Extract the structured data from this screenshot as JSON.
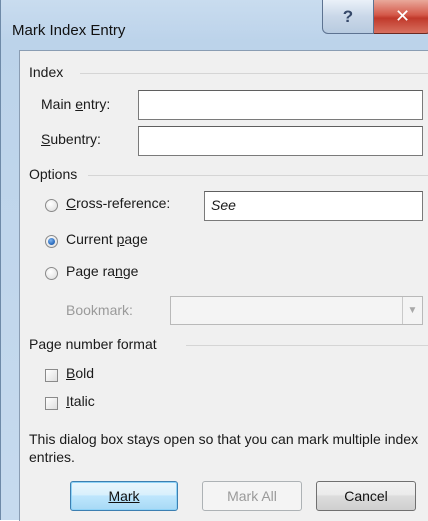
{
  "window": {
    "title": "Mark Index Entry",
    "help_glyph": "?",
    "close_glyph": "✕"
  },
  "index_group": {
    "label": "Index",
    "main_entry": {
      "pre": "Main ",
      "key": "e",
      "post": "ntry:",
      "value": ""
    },
    "subentry": {
      "pre": "",
      "key": "S",
      "post": "ubentry:",
      "value": ""
    }
  },
  "options_group": {
    "label": "Options",
    "cross_reference": {
      "pre": "",
      "key": "C",
      "post": "ross-reference:",
      "value": "See",
      "selected": false
    },
    "current_page": {
      "label": "Current page",
      "pre": "Current ",
      "key": "p",
      "post": "age",
      "selected": true
    },
    "page_range": {
      "pre": "Page ra",
      "key": "n",
      "post": "ge",
      "selected": false
    },
    "bookmark": {
      "label": "Bookmark:",
      "value": "",
      "enabled": false
    }
  },
  "format_group": {
    "label": "Page number format",
    "bold": {
      "key": "B",
      "post": "old",
      "checked": false
    },
    "italic": {
      "key": "I",
      "post": "talic",
      "checked": false
    }
  },
  "note": "This dialog box stays open so that you can mark multiple index entries.",
  "buttons": {
    "mark": "Mark",
    "mark_all": "Mark All",
    "cancel": "Cancel"
  }
}
